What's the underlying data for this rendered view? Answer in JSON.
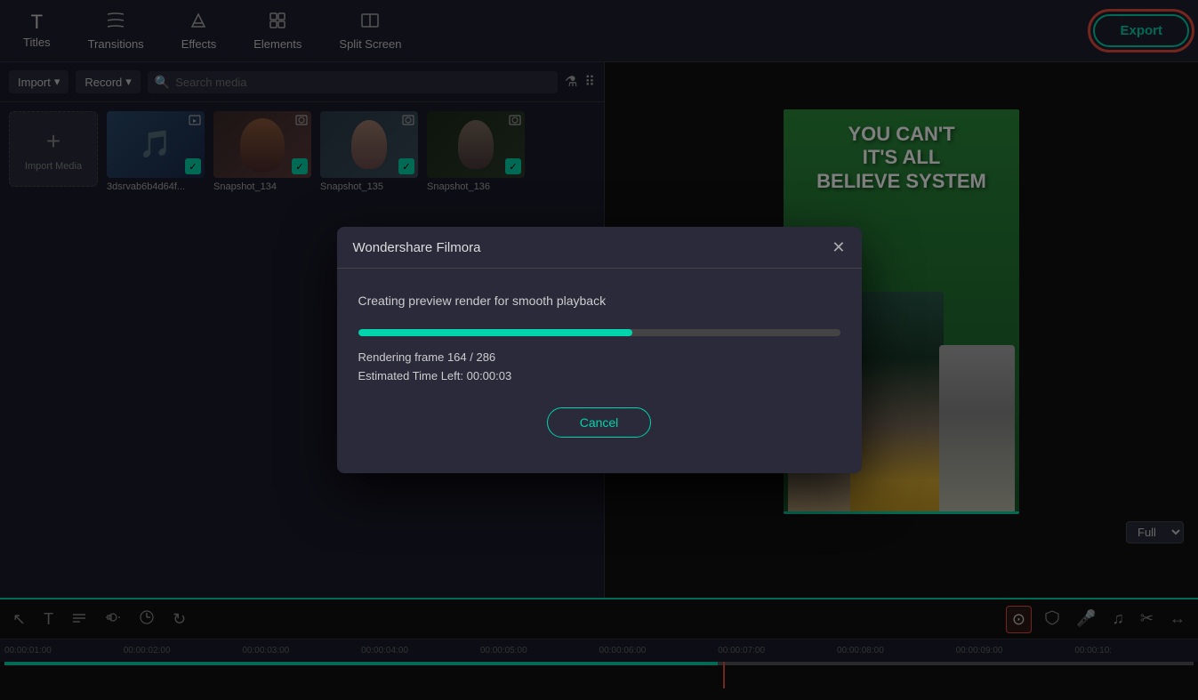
{
  "toolbar": {
    "titles_label": "Titles",
    "transitions_label": "Transitions",
    "effects_label": "Effects",
    "elements_label": "Elements",
    "split_screen_label": "Split Screen",
    "export_label": "Export"
  },
  "media_toolbar": {
    "import_label": "Import",
    "record_label": "Record",
    "search_placeholder": "Search media",
    "import_dropdown_icon": "▾",
    "record_dropdown_icon": "▾"
  },
  "media_items": [
    {
      "name": "Import Media",
      "type": "import"
    },
    {
      "name": "3dsrvab6b4d64f...",
      "type": "music"
    },
    {
      "name": "Snapshot_134",
      "type": "snapshot1"
    },
    {
      "name": "Snapshot_135",
      "type": "snapshot2"
    },
    {
      "name": "Snapshot_136",
      "type": "snapshot3"
    }
  ],
  "preview": {
    "zoom_label": "Full",
    "text_line1": "YOU CAN'T",
    "text_line2": "IT'S ALL",
    "text_line3": "BELIEVE SYSTEM"
  },
  "modal": {
    "title": "Wondershare Filmora",
    "close_icon": "✕",
    "description": "Creating preview render for smooth playback",
    "progress_pct": 57,
    "frame_current": 164,
    "frame_total": 286,
    "rendering_label": "Rendering frame 164 / 286",
    "eta_label": "Estimated Time Left: 00:00:03",
    "cancel_label": "Cancel"
  },
  "timeline": {
    "tools": [
      "T",
      "≡",
      "⊟",
      "◎",
      "↺"
    ],
    "right_tools": [
      "⊙",
      "🛡",
      "🎤",
      "♫",
      "✂",
      "↔"
    ],
    "zoom_label": "Full",
    "marks": [
      "00:00:01:00",
      "00:00:02:00",
      "00:00:03:00",
      "00:00:04:00",
      "00:00:05:00",
      "00:00:06:00",
      "00:00:07:00",
      "00:00:08:00",
      "00:00:09:00",
      "00:00:10:"
    ]
  }
}
